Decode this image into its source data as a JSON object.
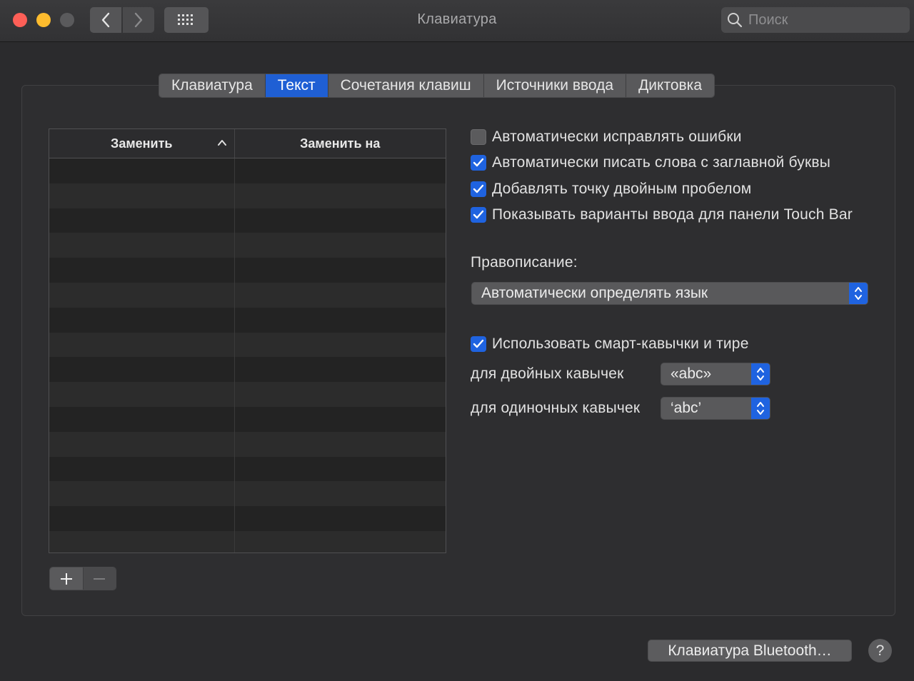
{
  "window": {
    "title": "Клавиатура",
    "search_placeholder": "Поиск"
  },
  "tabs": [
    {
      "label": "Клавиатура",
      "active": false
    },
    {
      "label": "Текст",
      "active": true
    },
    {
      "label": "Сочетания клавиш",
      "active": false
    },
    {
      "label": "Источники ввода",
      "active": false
    },
    {
      "label": "Диктовка",
      "active": false
    }
  ],
  "table": {
    "columns": [
      "Заменить",
      "Заменить на"
    ],
    "sort_column": "Заменить",
    "sort_direction": "ascending",
    "rows": []
  },
  "options": {
    "autocorrect": {
      "label": "Автоматически исправлять ошибки",
      "checked": false
    },
    "autocapitalize": {
      "label": "Автоматически писать слова с заглавной буквы",
      "checked": true
    },
    "double_space_period": {
      "label": "Добавлять точку двойным пробелом",
      "checked": true
    },
    "touchbar_suggestions": {
      "label": "Показывать варианты ввода для панели Touch Bar",
      "checked": true
    }
  },
  "spelling": {
    "label": "Правописание:",
    "value": "Автоматически определять язык"
  },
  "smart_quotes": {
    "label": "Использовать смарт-кавычки и тире",
    "checked": true,
    "double_label": "для двойных кавычек",
    "double_value": "«abc»",
    "single_label": "для одиночных кавычек",
    "single_value": "‘abc’"
  },
  "footer": {
    "bluetooth_button": "Клавиатура Bluetooth…",
    "help_button": "?"
  },
  "colors": {
    "accent": "#1f63e0",
    "background": "#2b2b2d",
    "close": "#fe5f57",
    "minimize": "#febc2e"
  }
}
